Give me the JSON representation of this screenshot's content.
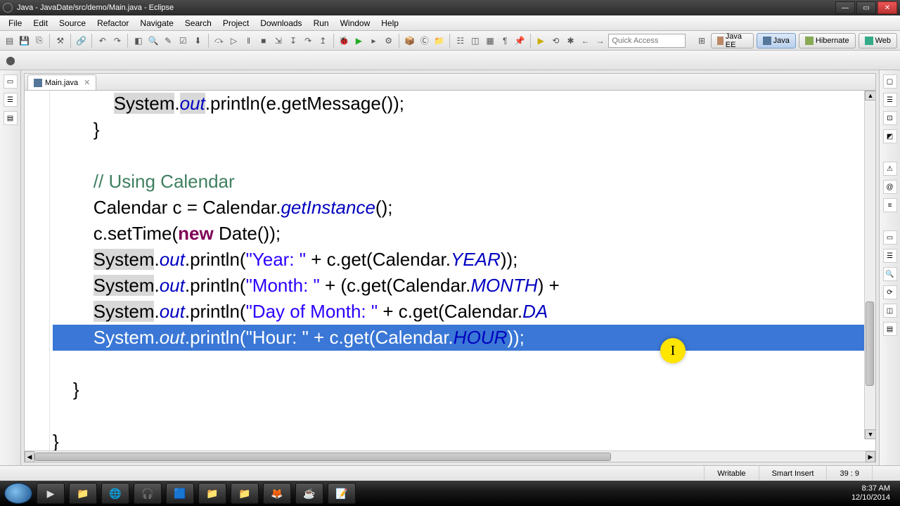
{
  "window": {
    "title": "Java - JavaDate/src/demo/Main.java - Eclipse"
  },
  "menu": [
    "File",
    "Edit",
    "Source",
    "Refactor",
    "Navigate",
    "Search",
    "Project",
    "Downloads",
    "Run",
    "Window",
    "Help"
  ],
  "quick_access": {
    "placeholder": "Quick Access"
  },
  "perspectives": [
    {
      "label": "Java EE",
      "icon": "#b86"
    },
    {
      "label": "Java",
      "icon": "#579",
      "active": true
    },
    {
      "label": "Hibernate",
      "icon": "#8a5"
    },
    {
      "label": "Web",
      "icon": "#3a8"
    }
  ],
  "tab": {
    "label": "Main.java"
  },
  "code_lines": [
    {
      "indent": 3,
      "tokens": [
        [
          "mark",
          "System"
        ],
        [
          ".",
          "p"
        ],
        [
          "fld mark",
          "out"
        ],
        [
          ".println(e.getMessage());",
          "p"
        ]
      ]
    },
    {
      "indent": 2,
      "tokens": [
        [
          "}",
          "p"
        ]
      ]
    },
    {
      "indent": 0,
      "tokens": []
    },
    {
      "indent": 2,
      "tokens": [
        [
          "// Using Calendar",
          "cm"
        ]
      ]
    },
    {
      "indent": 2,
      "tokens": [
        [
          "Calendar c = Calendar.",
          "p"
        ],
        [
          "getInstance",
          "fld"
        ],
        [
          "();",
          "p"
        ]
      ]
    },
    {
      "indent": 2,
      "tokens": [
        [
          "c.setTime(",
          "p"
        ],
        [
          "new",
          "kw"
        ],
        [
          " Date());",
          "p"
        ]
      ]
    },
    {
      "indent": 2,
      "tokens": [
        [
          "mark",
          "System"
        ],
        [
          ".",
          "p"
        ],
        [
          "fld",
          "out"
        ],
        [
          ".println(",
          "p"
        ],
        [
          "\"Year: \"",
          "str"
        ],
        [
          " + c.get(Calendar.",
          "p"
        ],
        [
          "YEAR",
          "cnst"
        ],
        [
          "));",
          "p"
        ]
      ]
    },
    {
      "indent": 2,
      "tokens": [
        [
          "mark",
          "System"
        ],
        [
          ".",
          "p"
        ],
        [
          "fld",
          "out"
        ],
        [
          ".println(",
          "p"
        ],
        [
          "\"Month: \"",
          "str"
        ],
        [
          " + (c.get(Calendar.",
          "p"
        ],
        [
          "MONTH",
          "cnst"
        ],
        [
          ") +",
          "p"
        ]
      ]
    },
    {
      "indent": 2,
      "tokens": [
        [
          "mark",
          "System"
        ],
        [
          ".",
          "p"
        ],
        [
          "fld",
          "out"
        ],
        [
          ".println(",
          "p"
        ],
        [
          "\"Day of Month: \"",
          "str"
        ],
        [
          " + c.get(Calendar.",
          "p"
        ],
        [
          "DA",
          "cnst"
        ]
      ]
    },
    {
      "indent": 2,
      "selected": true,
      "tokens": [
        [
          "System",
          "p"
        ],
        [
          ".",
          "p"
        ],
        [
          "fld",
          "out"
        ],
        [
          ".println(",
          "p"
        ],
        [
          "\"Hour: \"",
          "str"
        ],
        [
          " + c.get(Calendar.",
          "p"
        ],
        [
          "HOUR",
          "cnst"
        ],
        [
          "));",
          "p"
        ]
      ]
    },
    {
      "indent": 0,
      "tokens": []
    },
    {
      "indent": 1,
      "tokens": [
        [
          "}",
          "p"
        ]
      ]
    },
    {
      "indent": 0,
      "tokens": []
    },
    {
      "indent": 0,
      "tokens": [
        [
          "}",
          "p"
        ]
      ]
    }
  ],
  "status": {
    "writable": "Writable",
    "insert": "Smart Insert",
    "pos": "39 : 9"
  },
  "clock": {
    "time": "8:37 AM",
    "date": "12/10/2014"
  },
  "taskbar_icons": [
    "▶",
    "📁",
    "🌐",
    "🎧",
    "🟦",
    "📁",
    "📁",
    "🦊",
    "☕",
    "📝"
  ]
}
